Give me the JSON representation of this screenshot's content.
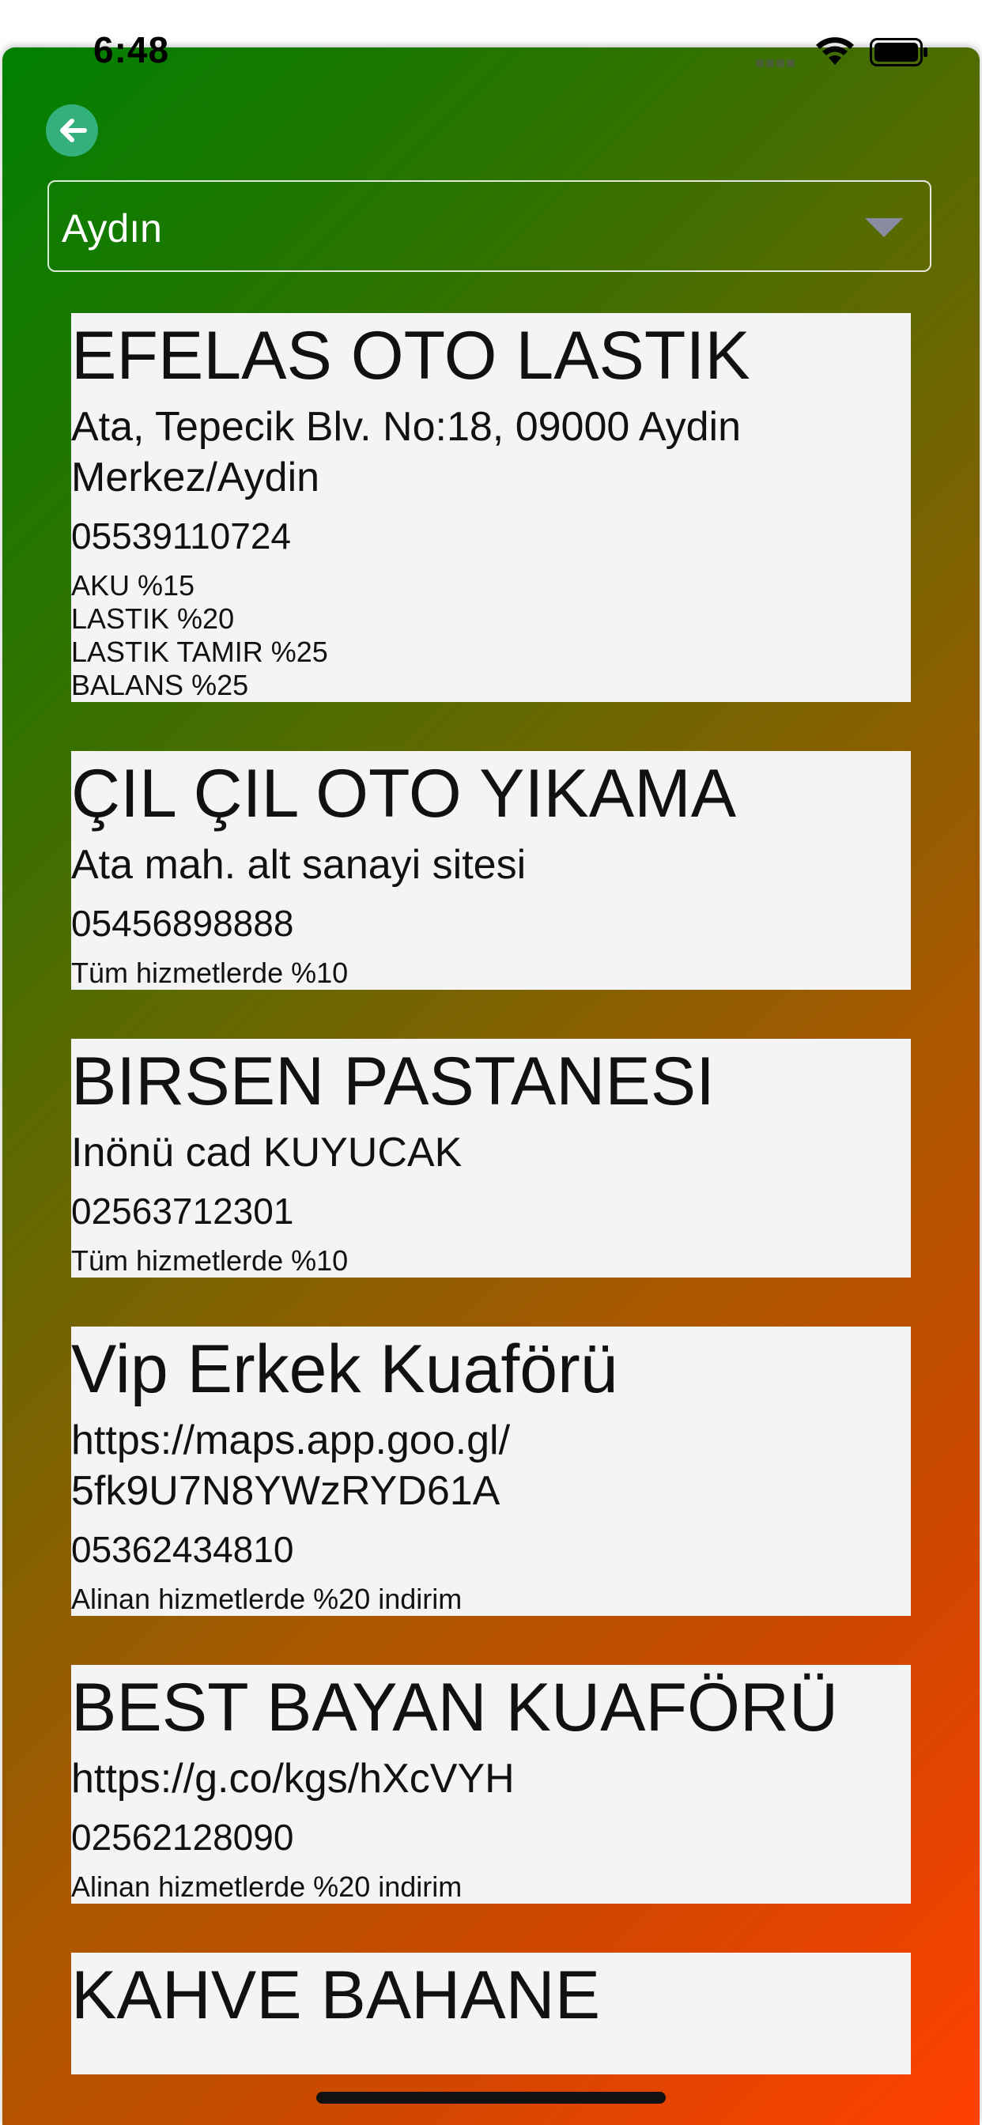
{
  "status_bar": {
    "time": "6:48"
  },
  "icons": {
    "back": "back-arrow-icon",
    "dropdown": "chevron-down-icon",
    "wifi": "wifi-icon",
    "battery": "battery-icon",
    "signal": "signal-icon"
  },
  "colors": {
    "gradient_start": "#008000",
    "gradient_end": "#ff4000",
    "card_background": "#f4f4f4",
    "back_button": "#34b07c"
  },
  "city_select": {
    "value": "Aydın"
  },
  "businesses": [
    {
      "name": "EFELAS OTO LASTIK",
      "address": "Ata, Tepecik Blv. No:18, 09000 Aydin Merkez/Aydin",
      "phone": "05539110724",
      "discount": "AKU %15\nLASTIK %20\nLASTIK TAMIR %25\nBALANS %25"
    },
    {
      "name": "ÇIL ÇIL OTO YIKAMA",
      "address": "Ata mah. alt sanayi sitesi",
      "phone": "05456898888",
      "discount": "Tüm hizmetlerde %10"
    },
    {
      "name": "BIRSEN PASTANESI",
      "address": "Inönü cad KUYUCAK",
      "phone": "02563712301",
      "discount": "Tüm hizmetlerde %10"
    },
    {
      "name": "Vip Erkek Kuaförü",
      "address": "https://maps.app.goo.gl/\n5fk9U7N8YWzRYD61A",
      "phone": "05362434810",
      "discount": "Alinan hizmetlerde %20 indirim"
    },
    {
      "name": "BEST BAYAN KUAFÖRÜ",
      "address": "https://g.co/kgs/hXcVYH",
      "phone": "02562128090",
      "discount": "Alinan hizmetlerde %20 indirim"
    },
    {
      "name": "KAHVE BAHANE"
    }
  ]
}
